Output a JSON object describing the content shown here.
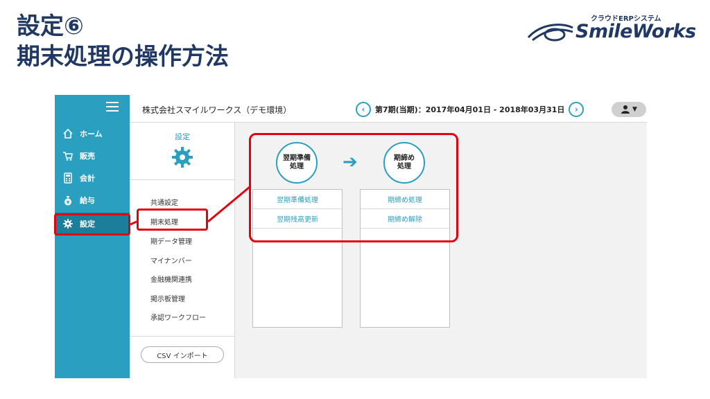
{
  "slide": {
    "title_line1": "設定⑥",
    "title_line2": "期末処理の操作方法",
    "logo_sub": "クラウドERPシステム",
    "logo_main": "SmileWorks"
  },
  "sidebar": {
    "items": [
      {
        "label": "ホーム",
        "icon": "home-icon"
      },
      {
        "label": "販売",
        "icon": "cart-icon"
      },
      {
        "label": "会計",
        "icon": "calculator-icon"
      },
      {
        "label": "給与",
        "icon": "money-bag-icon"
      },
      {
        "label": "設定",
        "icon": "gear-icon",
        "active": true
      }
    ]
  },
  "topbar": {
    "company": "株式会社スマイルワークス（デモ環境）",
    "period": "第7期(当期)：2017年04月01日 - 2018年03月31日"
  },
  "subnav": {
    "title": "設定",
    "items": [
      "共通設定",
      "期末処理",
      "期データ管理",
      "マイナンバー",
      "金融機関連携",
      "掲示板管理",
      "承認ワークフロー"
    ],
    "active": "期末処理",
    "csv_button": "CSV インポート"
  },
  "steps": {
    "step1": {
      "line1": "翌期準備",
      "line2": "処理",
      "actions": [
        "翌期準備処理",
        "翌期残高更新"
      ]
    },
    "step2": {
      "line1": "期締め",
      "line2": "処理",
      "actions": [
        "期締め処理",
        "期締め解除"
      ]
    }
  },
  "colors": {
    "accent": "#2a9fc0",
    "sidebar": "#2a9fc0",
    "highlight": "#e3000f",
    "title": "#1f3864"
  }
}
